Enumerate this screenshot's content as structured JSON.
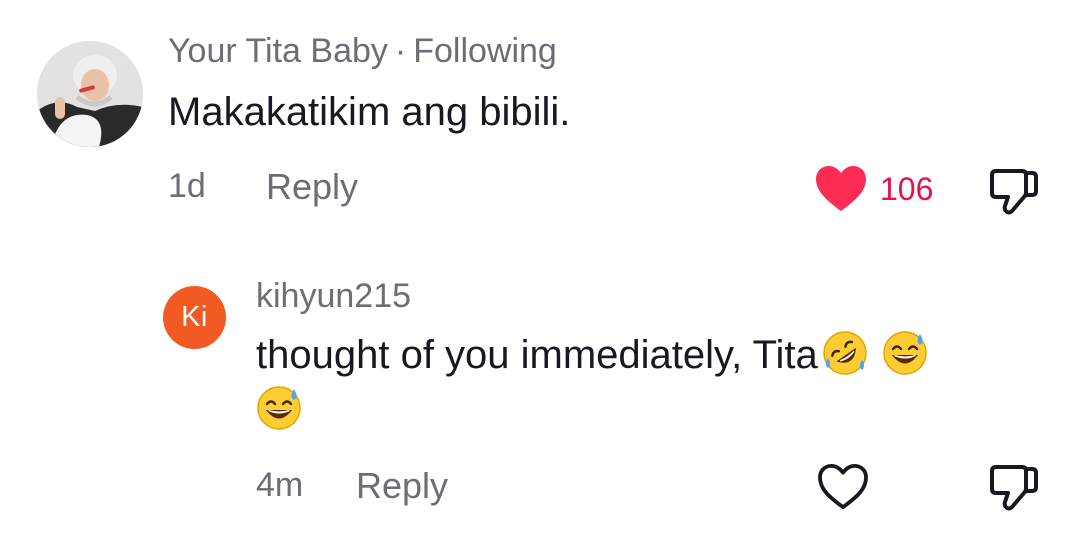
{
  "comments": [
    {
      "username": "Your Tita Baby",
      "separator": "·",
      "relationship": "Following",
      "text": "Makakatikim ang bibili.",
      "age": "1d",
      "reply_label": "Reply",
      "like_count": "106",
      "liked": true,
      "avatar": {
        "type": "photo"
      }
    },
    {
      "username": "kihyun215",
      "avatar": {
        "type": "initials",
        "initials": "Ki",
        "color": "#f15a22"
      },
      "text": "thought of you immediately, Tita",
      "emojis": [
        "rolling-on-floor-laughing-emoji",
        "grinning-sweat-emoji",
        "grinning-sweat-emoji"
      ],
      "age": "4m",
      "reply_label": "Reply",
      "liked": false
    }
  ],
  "colors": {
    "like_red": "#fe2c55",
    "text_primary": "#161823",
    "text_secondary": "#6b6e76"
  }
}
